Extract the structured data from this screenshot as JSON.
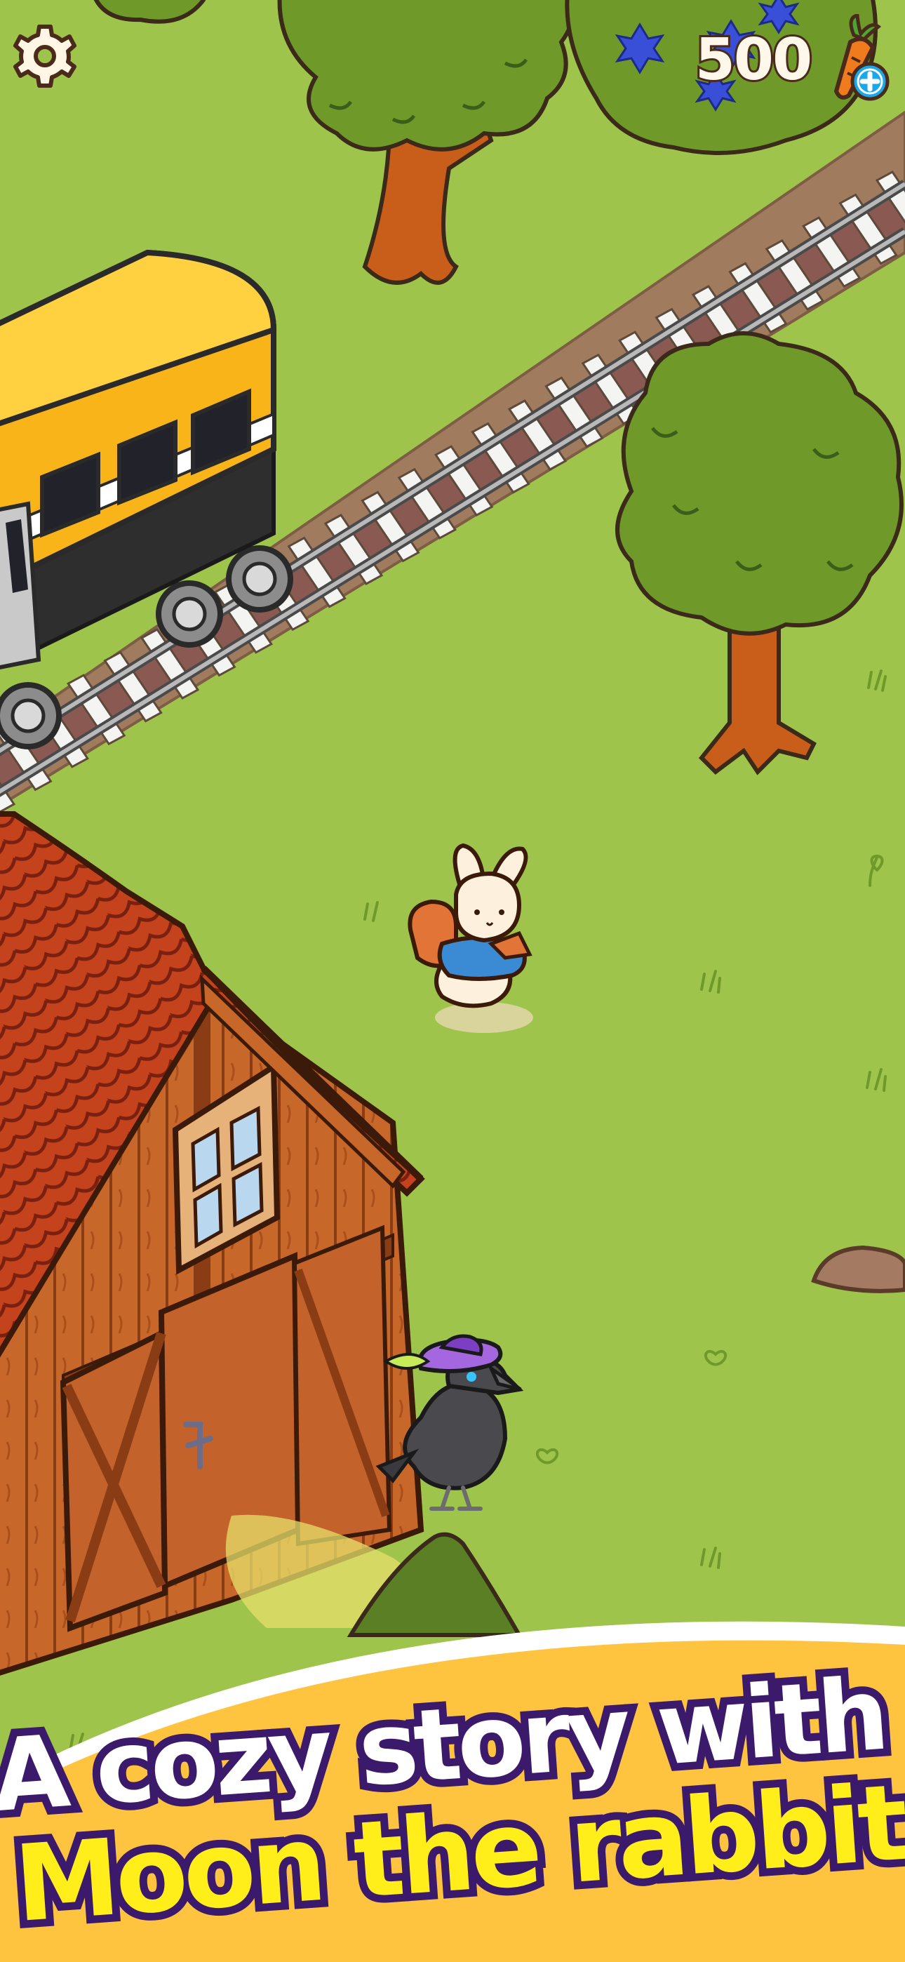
{
  "hud": {
    "currency_amount": "500",
    "currency_icon": "carrot-icon",
    "add_icon": "plus-icon",
    "settings_icon": "gear-icon"
  },
  "banner": {
    "line1": "A cozy story with",
    "line2": "Moon the rabbit"
  },
  "colors": {
    "grass": "#9fc44b",
    "banner_bg": "#fec33f",
    "tagline_outline": "#3b1a6b",
    "tagline_line2": "#ffee1a",
    "train": "#f8b418",
    "barn_roof": "#c4431c",
    "barn_wood": "#c7672a"
  }
}
